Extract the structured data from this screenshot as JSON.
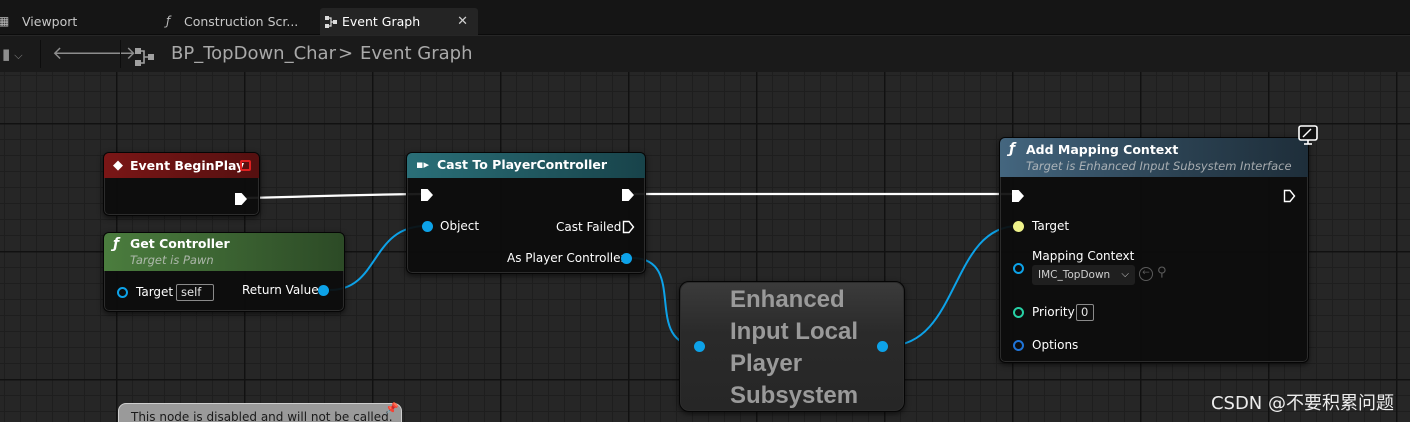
{
  "tabs": [
    {
      "label": "Viewport",
      "icon": "viewport-icon"
    },
    {
      "label": "Construction Scr...",
      "icon": "function-icon"
    },
    {
      "label": "Event Graph",
      "icon": "graph-icon",
      "active": true
    }
  ],
  "toolbar": {
    "breadcrumb_blueprint": "BP_TopDown_Char",
    "breadcrumb_separator": ">",
    "breadcrumb_graph": "Event Graph"
  },
  "nodes": {
    "event_begin_play": {
      "title": "Event BeginPlay",
      "color": "#7a1616"
    },
    "get_controller": {
      "title": "Get Controller",
      "subtitle": "Target is Pawn",
      "target_label": "Target",
      "target_value": "self",
      "return_label": "Return Value",
      "color": "#3f6b35"
    },
    "cast": {
      "title": "Cast To PlayerController",
      "object_label": "Object",
      "cast_failed_label": "Cast Failed",
      "as_label": "As Player Controller",
      "color": "#1e5a64"
    },
    "subsystem": {
      "title": "Enhanced Input Local Player Subsystem"
    },
    "add_mapping": {
      "title": "Add Mapping Context",
      "subtitle": "Target is Enhanced Input Subsystem Interface",
      "target_label": "Target",
      "mapping_label": "Mapping Context",
      "mapping_value": "IMC_TopDown",
      "priority_label": "Priority",
      "priority_value": "0",
      "options_label": "Options",
      "color": "#3e5d73"
    },
    "disabled_comment": {
      "text": "This node is disabled and will not be called."
    }
  },
  "colors": {
    "object_pin": "#0da2e8",
    "interface_pin": "#eef28a",
    "int_pin": "#27d0a5",
    "struct_pin": "#1f74d8",
    "exec_wire": "#ffffff"
  },
  "watermark": "CSDN @不要积累问题"
}
